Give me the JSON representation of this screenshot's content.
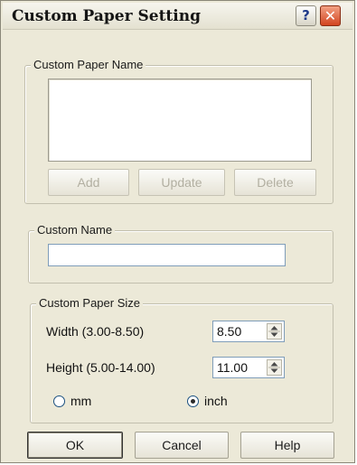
{
  "window": {
    "title": "Custom Paper Setting",
    "help_glyph": "?",
    "close_glyph": "✕"
  },
  "paper_name_group": {
    "legend": "Custom Paper Name",
    "items": [],
    "add_label": "Add",
    "update_label": "Update",
    "delete_label": "Delete"
  },
  "custom_name_group": {
    "legend": "Custom Name",
    "value": ""
  },
  "paper_size_group": {
    "legend": "Custom Paper Size",
    "width_label": "Width (3.00-8.50)",
    "width_value": "8.50",
    "height_label": "Height (5.00-14.00)",
    "height_value": "11.00",
    "unit_options": [
      "mm",
      "inch"
    ],
    "mm_label": "mm",
    "inch_label": "inch",
    "selected_unit": "inch"
  },
  "footer": {
    "ok_label": "OK",
    "cancel_label": "Cancel",
    "help_label": "Help"
  },
  "icons": {
    "help": "question-mark-icon",
    "close": "close-icon",
    "spin_up": "spin-up-icon",
    "spin_down": "spin-down-icon"
  },
  "colors": {
    "dialog_bg": "#ece9d8",
    "close_button": "#d2441f",
    "input_border": "#7f9db9"
  }
}
